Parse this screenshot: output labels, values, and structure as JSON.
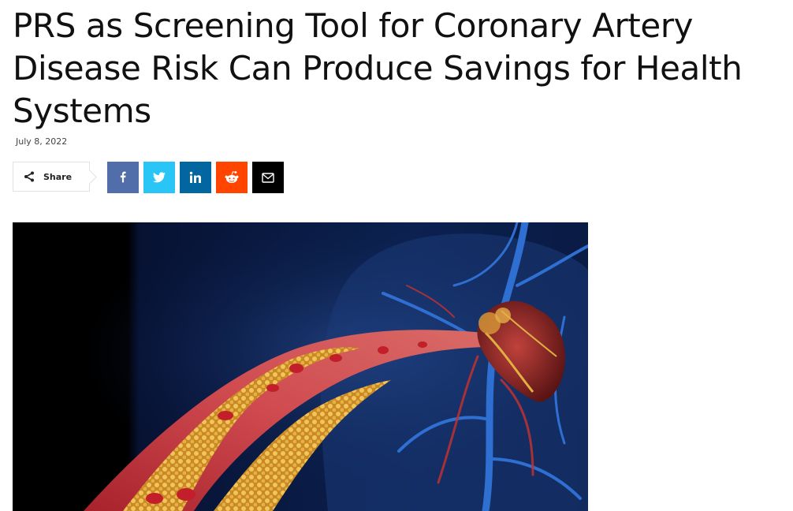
{
  "article": {
    "title": "PRS as Screening Tool for Coronary Artery Disease Risk Can Produce Savings for Health Systems",
    "date": "July 8, 2022"
  },
  "share": {
    "label": "Share",
    "icon": "share-icon",
    "buttons": [
      {
        "network": "facebook",
        "icon": "facebook-icon",
        "color": "#516eab"
      },
      {
        "network": "twitter",
        "icon": "twitter-icon",
        "color": "#29c5f6"
      },
      {
        "network": "linkedin",
        "icon": "linkedin-icon",
        "color": "#0266a0"
      },
      {
        "network": "reddit",
        "icon": "reddit-icon",
        "color": "#ff4500"
      },
      {
        "network": "email",
        "icon": "envelope-icon",
        "color": "#000000"
      }
    ]
  },
  "hero_image": {
    "subject": "illustration of a heart with an artery narrowed by plaque",
    "colors": {
      "background": "#050a1c",
      "artery": "#b8323a",
      "plaque": "#d9a23a",
      "vein": "#2f6fd1"
    }
  }
}
